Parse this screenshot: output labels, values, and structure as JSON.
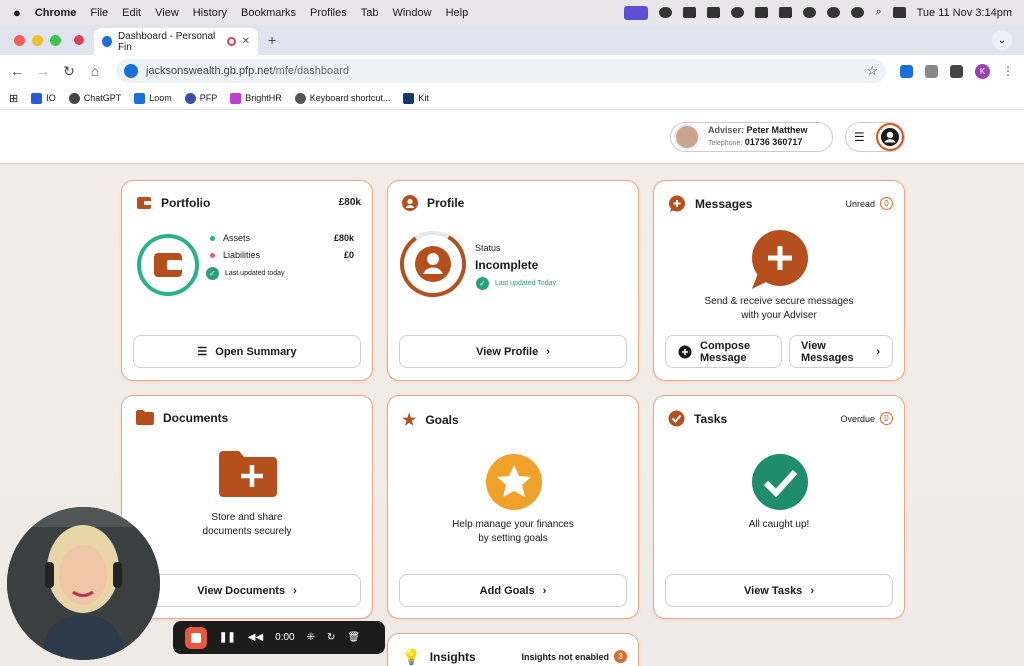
{
  "menubar": {
    "app": "Chrome",
    "items": [
      "File",
      "Edit",
      "View",
      "History",
      "Bookmarks",
      "Profiles",
      "Tab",
      "Window",
      "Help"
    ],
    "clock": "Tue 11 Nov  3:14pm"
  },
  "browser": {
    "tab_title": "Dashboard - Personal Fin",
    "url_domain": "jacksonswealth.gb.pfp.net",
    "url_path": "/mfe/dashboard",
    "profile_letter": "K",
    "bookmarks": [
      "IO",
      "ChatGPT",
      "Loom",
      "PFP",
      "BrightHR",
      "Keyboard shortcut...",
      "Kit"
    ]
  },
  "header": {
    "adviser_label": "Adviser:",
    "adviser_name": "Peter Matthew",
    "telephone_label": "Telephone:",
    "telephone": "01736 360717"
  },
  "portfolio": {
    "title": "Portfolio",
    "total": "£80k",
    "assets_label": "Assets",
    "assets": "£80k",
    "liabilities_label": "Liabilities",
    "liabilities": "£0",
    "updated": "Last updated today",
    "button": "Open Summary"
  },
  "profile": {
    "title": "Profile",
    "status_label": "Status",
    "status": "Incomplete",
    "updated": "Last updated Today",
    "button": "View Profile"
  },
  "messages": {
    "title": "Messages",
    "unread_label": "Unread",
    "unread": "0",
    "desc1": "Send & receive secure messages",
    "desc2": "with your Adviser",
    "compose_1": "Compose",
    "compose_2": "Message",
    "view_1": "View",
    "view_2": "Messages"
  },
  "documents": {
    "title": "Documents",
    "desc1": "Store and share",
    "desc2": "documents securely",
    "button": "View Documents"
  },
  "goals": {
    "title": "Goals",
    "desc1": "Help manage your finances",
    "desc2": "by setting goals",
    "button": "Add Goals"
  },
  "tasks": {
    "title": "Tasks",
    "overdue_label": "Overdue",
    "overdue": "0",
    "desc": "All caught up!",
    "button": "View Tasks"
  },
  "insights": {
    "title": "Insights",
    "status": "Insights not enabled",
    "count": "3"
  },
  "recorder": {
    "time": "0:00"
  },
  "colors": {
    "brand": "#b5501e",
    "accent": "#e06a2a",
    "success": "#2aa07a",
    "goal": "#f0a12a"
  }
}
